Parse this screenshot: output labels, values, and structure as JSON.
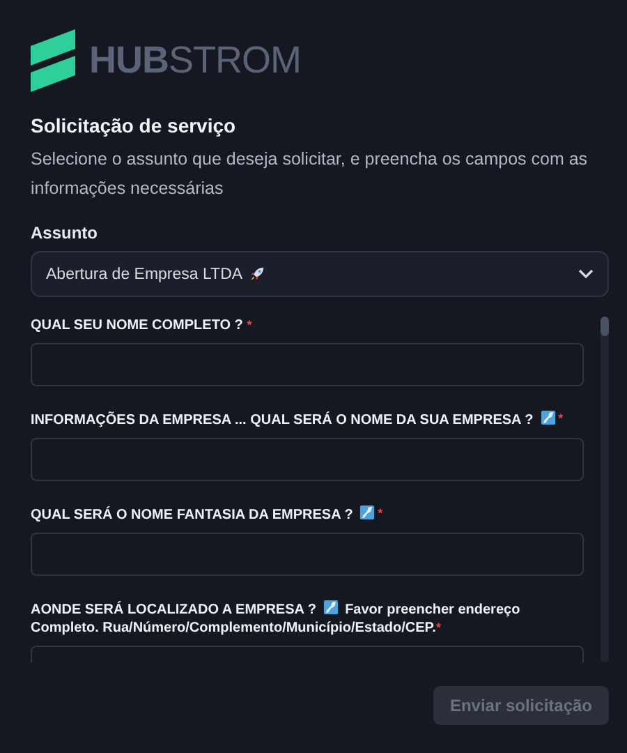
{
  "logo": {
    "text": "**HUB**STROM"
  },
  "heading": "Solicitação de serviço",
  "description": "Selecione o assunto que deseja solicitar, e preencha os campos com as informações necessárias",
  "subject": {
    "label": "Assunto",
    "value": "Abertura de Empresa LTDA"
  },
  "questions": [
    {
      "label": "QUAL SEU NOME COMPLETO ?",
      "kind": "plain",
      "required_mark": "*"
    },
    {
      "label": "INFORMAÇÕES DA EMPRESA ... QUAL SERÁ O NOME DA SUA EMPRESA ?",
      "kind": "emoji",
      "required_mark": "*"
    },
    {
      "label": "QUAL SERÁ O NOME FANTASIA DA EMPRESA ?",
      "kind": "emoji",
      "required_mark": "*"
    },
    {
      "label": "AONDE SERÁ LOCALIZADO A EMPRESA ?",
      "kind": "emoji",
      "after_icon": "Favor preencher endereço Completo. Rua/Número/Complemento/Município/Estado/CEP.",
      "required_mark": "*"
    }
  ],
  "submit": {
    "label": "Enviar solicitação",
    "disabled": true
  }
}
